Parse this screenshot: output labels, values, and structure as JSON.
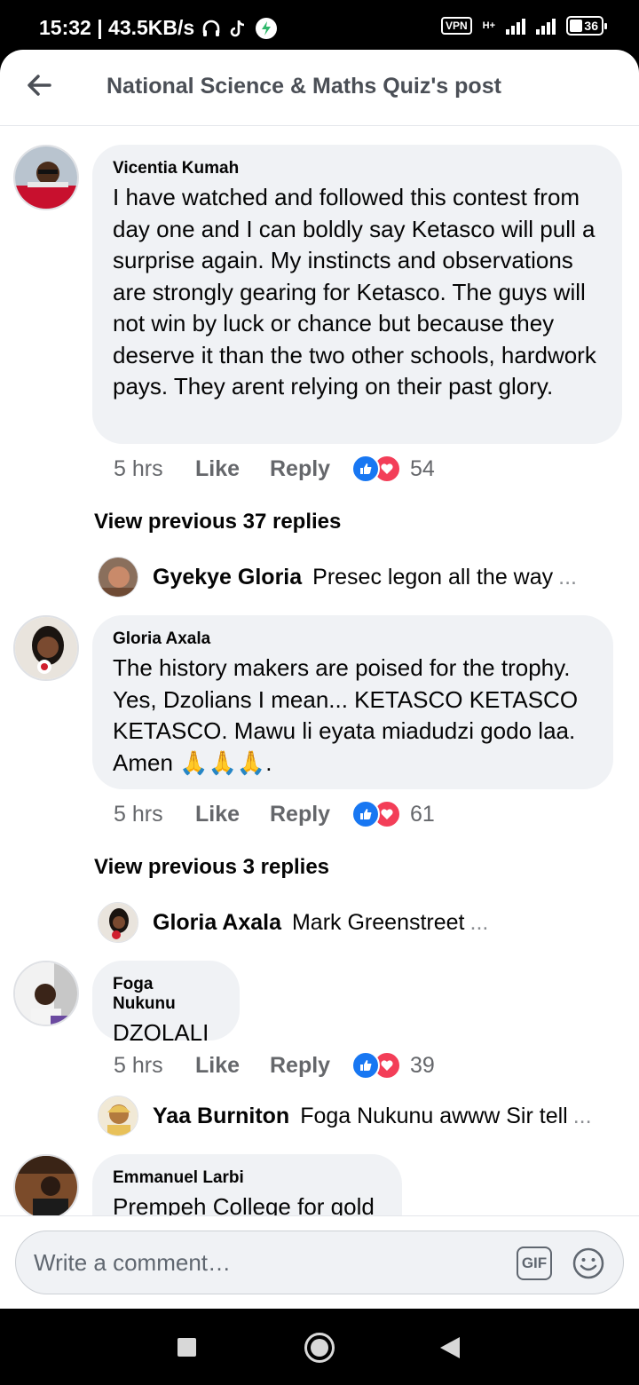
{
  "status_bar": {
    "time_speed": "15:32 | 43.5KB/s",
    "vpn": "VPN",
    "network": "H+",
    "battery": "36"
  },
  "header": {
    "title": "National Science & Maths Quiz's post"
  },
  "comments": [
    {
      "name": "Vicentia Kumah",
      "text": "I have watched and followed this contest from day one and I can boldly say Ketasco will pull a surprise again. My instincts and observations are strongly gearing for Ketasco. The guys will not win by luck or chance but because they deserve it than the two other schools, hardwork pays. They arent relying on their past glory.",
      "time": "5 hrs",
      "like": "Like",
      "reply": "Reply",
      "reactions": "54",
      "view_previous": "View previous 37 replies",
      "latest_reply": {
        "name": "Gyekye Gloria",
        "text": "Presec legon all the way",
        "more": "..."
      }
    },
    {
      "name": "Gloria Axala",
      "text": "The history makers are poised for the trophy. Yes, Dzolians I mean... KETASCO KETASCO KETASCO.  Mawu li eyata miadudzi godo laa. Amen 🙏🙏🙏.",
      "time": "5 hrs",
      "like": "Like",
      "reply": "Reply",
      "reactions": "61",
      "view_previous": "View previous 3 replies",
      "latest_reply": {
        "name": "Gloria Axala",
        "text": "Mark Greenstreet",
        "more": "..."
      }
    },
    {
      "name": "Foga Nukunu",
      "text": "DZOLALI",
      "time": "5 hrs",
      "like": "Like",
      "reply": "Reply",
      "reactions": "39",
      "latest_reply": {
        "name": "Yaa Burniton",
        "text": "Foga Nukunu awww Sir tell",
        "more": "..."
      }
    },
    {
      "name": "Emmanuel Larbi",
      "text": "Prempeh College for gold"
    }
  ],
  "composer": {
    "placeholder": "Write a comment…",
    "gif": "GIF"
  },
  "colors": {
    "bubble": "#f0f2f5",
    "like_blue": "#1877f2",
    "love_red": "#f33e58",
    "meta_gray": "#65676b"
  }
}
